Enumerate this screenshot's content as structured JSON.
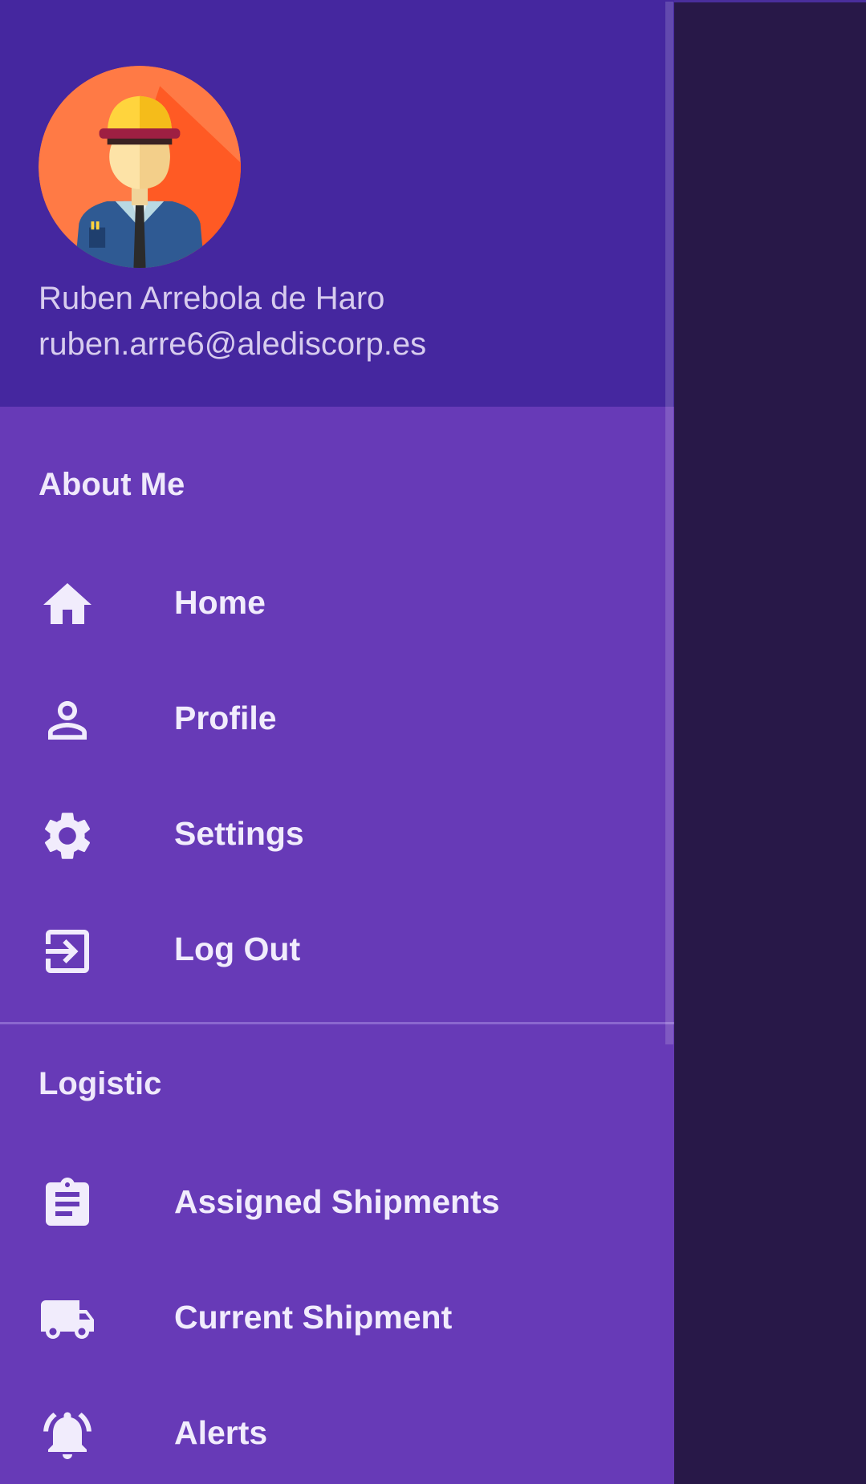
{
  "drawer": {
    "header": {
      "user_name": "Ruben Arrebola de Haro",
      "user_email": "ruben.arre6@alediscorp.es",
      "avatar_icon": "worker-avatar-icon"
    },
    "sections": [
      {
        "title": "About Me",
        "items": [
          {
            "label": "Home",
            "icon": "home-icon"
          },
          {
            "label": "Profile",
            "icon": "person-icon"
          },
          {
            "label": "Settings",
            "icon": "gear-icon"
          },
          {
            "label": "Log Out",
            "icon": "logout-icon"
          }
        ]
      },
      {
        "title": "Logistic",
        "items": [
          {
            "label": "Assigned Shipments",
            "icon": "clipboard-icon"
          },
          {
            "label": "Current Shipment",
            "icon": "truck-icon"
          },
          {
            "label": "Alerts",
            "icon": "bell-ringing-icon"
          }
        ]
      }
    ]
  },
  "colors": {
    "header_bg": "#45279f",
    "drawer_bg": "#673ab7",
    "scrim": "#281848",
    "text_primary": "#f1ecfc",
    "text_secondary": "#d7ccee"
  }
}
